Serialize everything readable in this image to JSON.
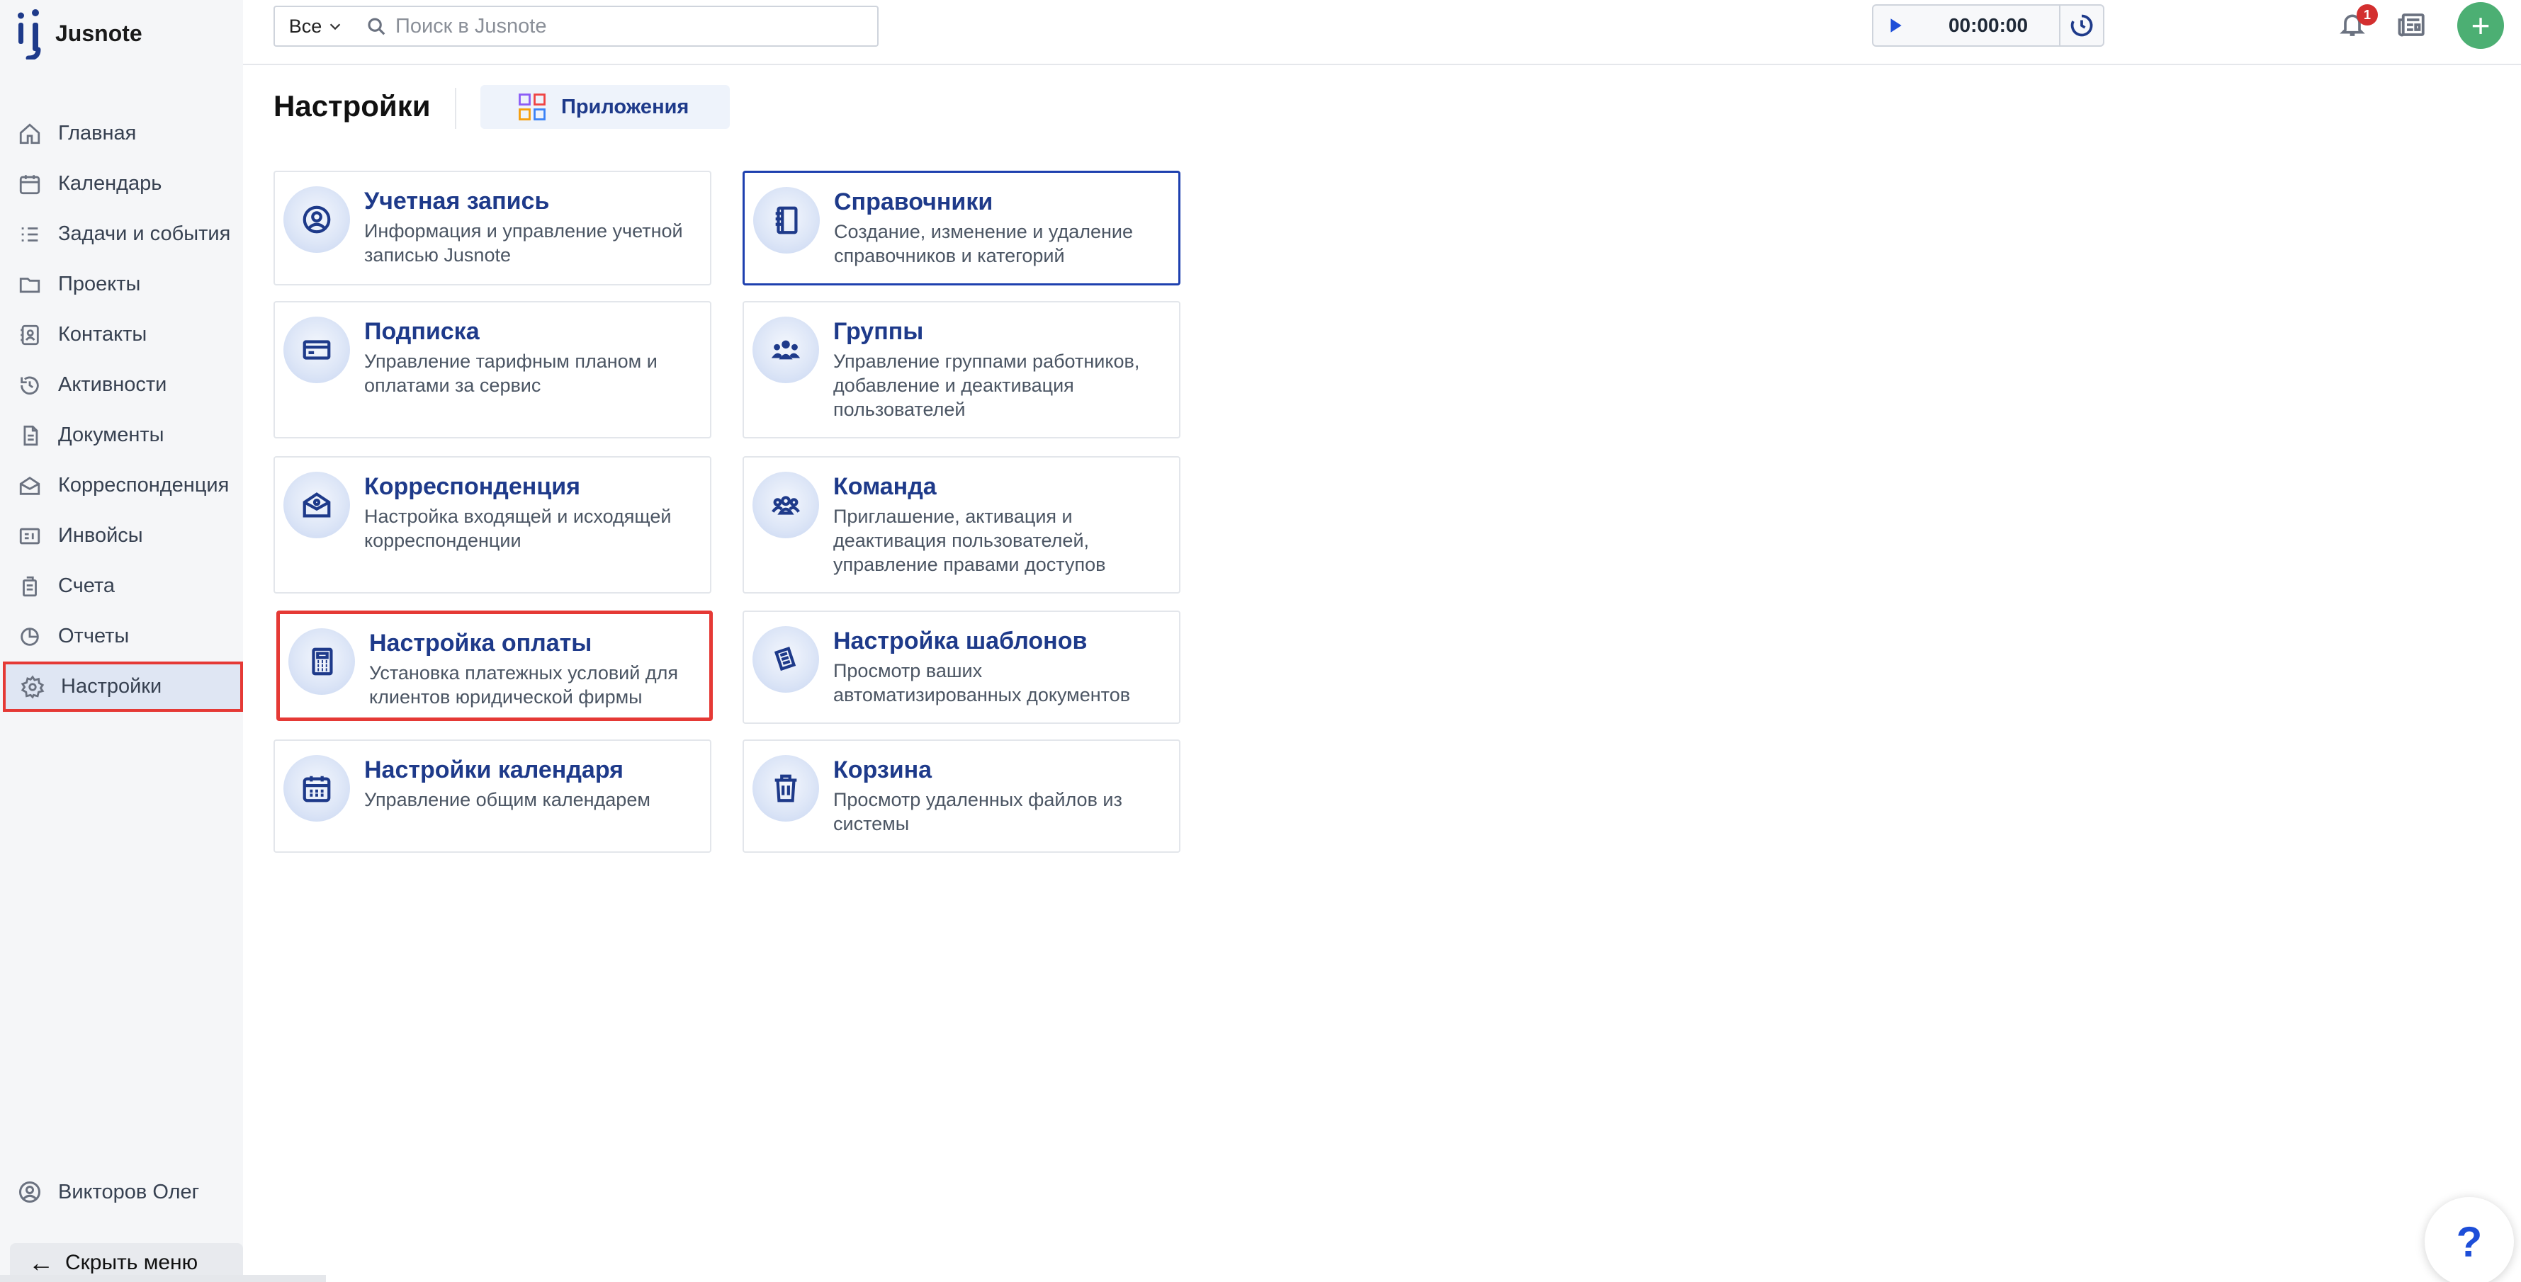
{
  "app": {
    "name": "Jusnote"
  },
  "sidebar": {
    "items": [
      {
        "label": "Главная",
        "icon": "home-icon"
      },
      {
        "label": "Календарь",
        "icon": "calendar-icon"
      },
      {
        "label": "Задачи и события",
        "icon": "tasks-icon"
      },
      {
        "label": "Проекты",
        "icon": "folder-icon"
      },
      {
        "label": "Контакты",
        "icon": "contacts-icon"
      },
      {
        "label": "Активности",
        "icon": "history-icon"
      },
      {
        "label": "Документы",
        "icon": "documents-icon"
      },
      {
        "label": "Корреспонденция",
        "icon": "mail-icon"
      },
      {
        "label": "Инвойсы",
        "icon": "invoice-icon"
      },
      {
        "label": "Счета",
        "icon": "bank-icon"
      },
      {
        "label": "Отчеты",
        "icon": "report-icon"
      },
      {
        "label": "Настройки",
        "icon": "gear-icon",
        "active": true
      }
    ],
    "user": {
      "name": "Викторов Олег"
    },
    "collapse_label": "Скрыть меню"
  },
  "topbar": {
    "scope_label": "Все",
    "search_placeholder": "Поиск в Jusnote",
    "timer": "00:00:00",
    "notifications_count": "1"
  },
  "page": {
    "title": "Настройки",
    "apps_button": "Приложения"
  },
  "cards": [
    {
      "title": "Учетная запись",
      "desc": "Информация и управление учетной записью Jusnote",
      "icon": "user-circle-icon"
    },
    {
      "title": "Справочники",
      "desc": "Создание, изменение и удаление справочников и категорий",
      "icon": "book-icon"
    },
    {
      "title": "Подписка",
      "desc": "Управление тарифным планом и оплатами за сервис",
      "icon": "credit-card-icon"
    },
    {
      "title": "Группы",
      "desc": "Управление группами работников, добавление и деактивация пользователей",
      "icon": "users-group-icon"
    },
    {
      "title": "Корреспонденция",
      "desc": "Настройка входящей и исходящей корреспонденции",
      "icon": "envelope-icon"
    },
    {
      "title": "Команда",
      "desc": "Приглашение, активация и деактивация пользователей, управление правами доступов",
      "icon": "team-icon"
    },
    {
      "title": "Настройка оплаты",
      "desc": "Установка платежных условий для клиентов юридической фирмы",
      "icon": "calculator-icon"
    },
    {
      "title": "Настройка шаблонов",
      "desc": "Просмотр ваших автоматизированных документов",
      "icon": "templates-icon"
    },
    {
      "title": "Настройки календаря",
      "desc": "Управление общим календарем",
      "icon": "calendar-grid-icon"
    },
    {
      "title": "Корзина",
      "desc": "Просмотр удаленных файлов из системы",
      "icon": "trash-icon"
    }
  ],
  "help_label": "?",
  "colors": {
    "accent": "#1e3a8a",
    "highlight": "#e53935",
    "add_button": "#4caf73",
    "badge": "#d32f2f"
  }
}
